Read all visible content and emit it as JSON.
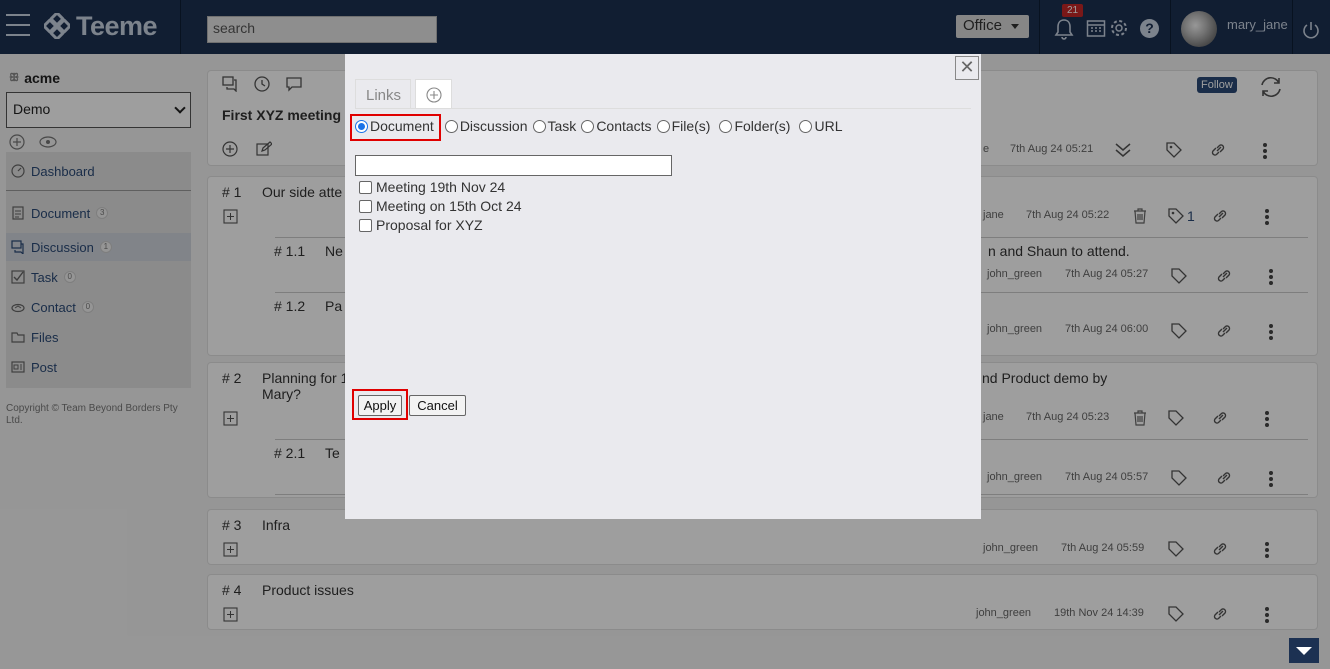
{
  "app": {
    "name": "Teeme",
    "search_placeholder": "search",
    "space": "Office",
    "notif_count": "21",
    "user": "mary_jane"
  },
  "sidebar": {
    "org": "acme",
    "workspace": "Demo",
    "items": [
      {
        "label": "Dashboard",
        "icon": "dashboard-icon"
      },
      {
        "label": "Document",
        "count": "3",
        "icon": "document-icon"
      },
      {
        "label": "Discussion",
        "count": "1",
        "icon": "discussion-icon"
      },
      {
        "label": "Task",
        "count": "0",
        "icon": "task-icon"
      },
      {
        "label": "Contact",
        "count": "0",
        "icon": "contact-icon"
      },
      {
        "label": "Files",
        "icon": "folder-icon"
      },
      {
        "label": "Post",
        "icon": "post-icon"
      }
    ],
    "copyright": "Copyright © Team Beyond Borders Pty Ltd."
  },
  "header": {
    "title": "First XYZ meeting",
    "follow": "Follow",
    "meta_user": "e",
    "meta_time": "7th Aug 24 05:21"
  },
  "threads": [
    {
      "num": "# 1",
      "title": "Our side atte",
      "user": "jane",
      "time": "7th Aug 24 05:22",
      "tags": "1"
    },
    {
      "num": "# 1.1",
      "title": "Ne",
      "tail": "n and Shaun to attend.",
      "user": "john_green",
      "time": "7th Aug 24 05:27"
    },
    {
      "num": "# 1.2",
      "title": "Pa",
      "user": "john_green",
      "time": "7th Aug 24 06:00"
    },
    {
      "num": "# 2",
      "title": "Planning for 1",
      "title2": "Mary?",
      "tail": "nd Product demo by",
      "user": "jane",
      "time": "7th Aug 24 05:23"
    },
    {
      "num": "# 2.1",
      "title": "Te",
      "user": "john_green",
      "time": "7th Aug 24 05:57"
    },
    {
      "num": "# 3",
      "title": "Infra",
      "user": "john_green",
      "time": "7th Aug 24 05:59"
    },
    {
      "num": "# 4",
      "title": "Product issues",
      "user": "john_green",
      "time": "19th Nov 24 14:39"
    }
  ],
  "modal": {
    "tab_links": "Links",
    "close": "✕",
    "radio_options": [
      "Document",
      "Discussion",
      "Task",
      "Contacts",
      "File(s)",
      "Folder(s)",
      "URL"
    ],
    "selected_radio": "Document",
    "filter_value": "",
    "items": [
      "Meeting 19th Nov 24",
      "Meeting on 15th Oct 24",
      "Proposal for XYZ"
    ],
    "apply": "Apply",
    "cancel": "Cancel"
  },
  "colors": {
    "topbar": "#1c3152",
    "link": "#2b4a76",
    "highlight": "#e00000"
  }
}
